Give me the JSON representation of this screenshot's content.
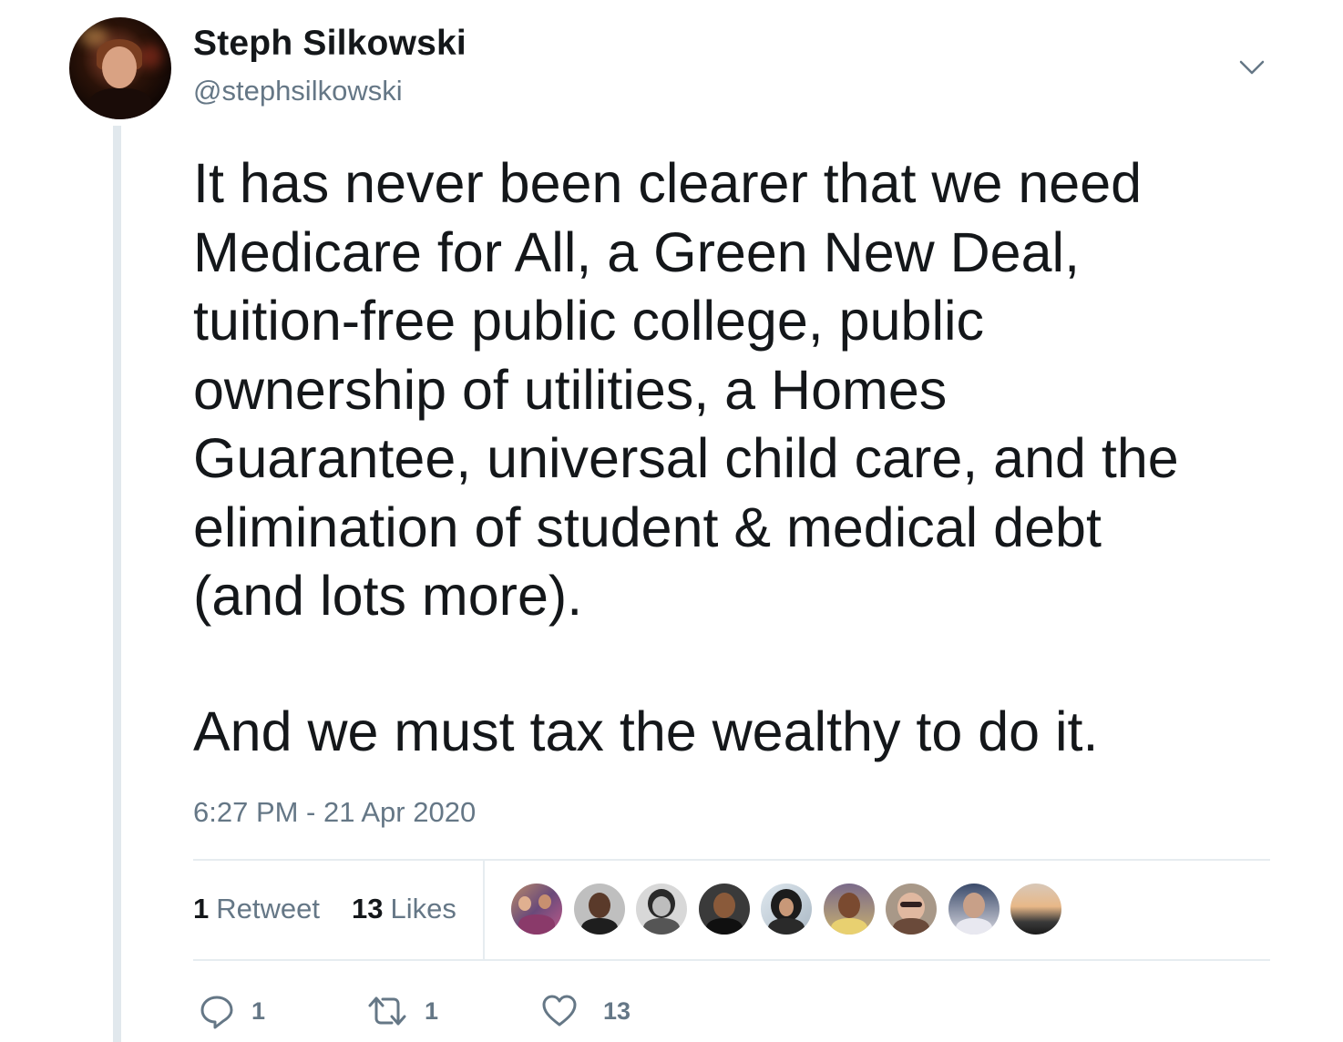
{
  "author": {
    "name": "Steph Silkowski",
    "handle": "@stephsilkowski"
  },
  "tweet": {
    "text": "It has never been clearer that we need\nMedicare for All, a Green New Deal,\ntuition-free public college, public\nownership of utilities, a Homes\nGuarantee, universal child care, and the\nelimination of student & medical debt\n(and lots more).",
    "text2": "And we must tax the wealthy to do it.",
    "timestamp": "6:27 PM - 21 Apr 2020"
  },
  "stats": {
    "retweet_count": "1",
    "retweet_label": "Retweet",
    "like_count": "13",
    "like_label": "Likes"
  },
  "likers_count_shown": 9,
  "actions": {
    "reply_count": "1",
    "retweet_count": "1",
    "like_count": "13"
  },
  "colors": {
    "text": "#14171a",
    "secondary": "#657786",
    "divider": "#e6ecf0",
    "thread_line": "#e1e8ed"
  },
  "icons": [
    "caret-down-icon",
    "reply-icon",
    "retweet-icon",
    "heart-icon"
  ]
}
